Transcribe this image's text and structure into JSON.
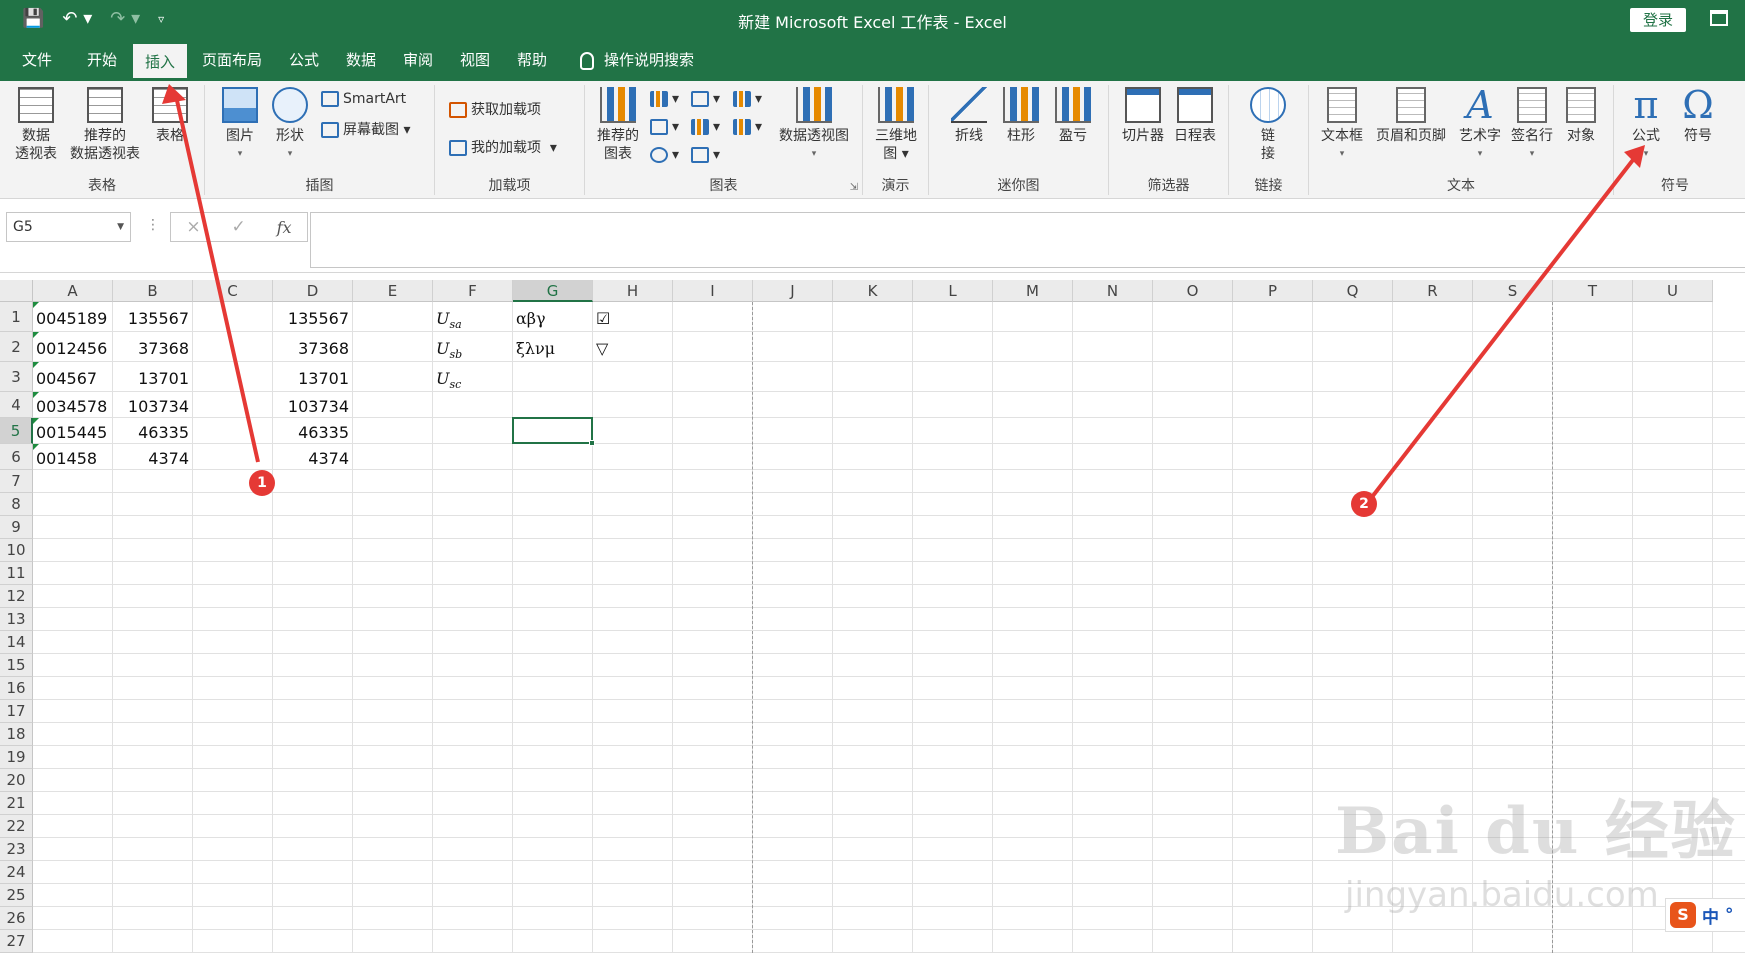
{
  "window": {
    "title": "新建 Microsoft Excel 工作表  -  Excel",
    "login_label": "登录",
    "qat": {
      "save_icon": "save-icon",
      "undo_icon": "undo-icon",
      "redo_icon": "redo-icon",
      "customize_icon": "customize-qat-icon"
    }
  },
  "tabs": {
    "file": "文件",
    "home": "开始",
    "insert": "插入",
    "page_layout": "页面布局",
    "formulas": "公式",
    "data": "数据",
    "review": "审阅",
    "view": "视图",
    "help": "帮助",
    "tell_me": "操作说明搜索",
    "active": "插入"
  },
  "ribbon": {
    "tables": {
      "label": "表格",
      "pivot_line1": "数据",
      "pivot_line2": "透视表",
      "rec_pivot_line1": "推荐的",
      "rec_pivot_line2": "数据透视表",
      "table": "表格"
    },
    "illustrations": {
      "label": "插图",
      "pictures": "图片",
      "shapes": "形状",
      "smartart": "SmartArt",
      "screenshot": "屏幕截图"
    },
    "addins": {
      "label": "加载项",
      "get": "获取加载项",
      "my": "我的加载项"
    },
    "charts": {
      "label": "图表",
      "recommended_line1": "推荐的",
      "recommended_line2": "图表",
      "pivotchart": "数据透视图"
    },
    "tours": {
      "label": "演示",
      "map3d_line1": "三维地",
      "map3d_line2": "图"
    },
    "sparklines": {
      "label": "迷你图",
      "line": "折线",
      "column": "柱形",
      "winloss": "盈亏"
    },
    "filters": {
      "label": "筛选器",
      "slicer": "切片器",
      "timeline": "日程表"
    },
    "links": {
      "label": "链接",
      "link_line1": "链",
      "link_line2": "接"
    },
    "text": {
      "label": "文本",
      "textbox": "文本框",
      "header_footer": "页眉和页脚",
      "wordart": "艺术字",
      "signature": "签名行",
      "object": "对象"
    },
    "symbols": {
      "label": "符号",
      "equation": "公式",
      "symbol": "符号"
    }
  },
  "formula_bar": {
    "name_box": "G5",
    "cancel_icon": "×",
    "enter_icon": "✓",
    "fx": "fx",
    "content": ""
  },
  "sheet": {
    "columns": [
      "A",
      "B",
      "C",
      "D",
      "E",
      "F",
      "G",
      "H",
      "I",
      "J",
      "K",
      "L",
      "M",
      "N",
      "O",
      "P",
      "Q",
      "R",
      "S",
      "T",
      "U"
    ],
    "rows": [
      "1",
      "2",
      "3",
      "4",
      "5",
      "6",
      "7",
      "8",
      "9",
      "10",
      "11",
      "12",
      "13",
      "14",
      "15",
      "16",
      "17",
      "18",
      "19",
      "20",
      "21",
      "22",
      "23",
      "24",
      "25",
      "26",
      "27"
    ],
    "selected_cell": "G5",
    "colA": [
      "0045189",
      "0012456",
      "004567",
      "0034578",
      "0015445",
      "001458"
    ],
    "colB": [
      "135567",
      "37368",
      "13701",
      "103734",
      "46335",
      "4374"
    ],
    "colD": [
      "135567",
      "37368",
      "13701",
      "103734",
      "46335",
      "4374"
    ],
    "colF": [
      {
        "base": "U",
        "sub": "sa"
      },
      {
        "base": "U",
        "sub": "sb"
      },
      {
        "base": "U",
        "sub": "sc"
      }
    ],
    "colG": [
      "αβγ",
      "ξλνμ"
    ],
    "colH": [
      "☑",
      "▽"
    ]
  },
  "annotations": {
    "badge1": "1",
    "badge2": "2",
    "arrow_color": "#e53935"
  },
  "watermark": {
    "main": "Bai du 经验",
    "sub": "jingyan.baidu.com"
  },
  "ime": {
    "logo": "S",
    "mode": "中",
    "dot": "°"
  }
}
